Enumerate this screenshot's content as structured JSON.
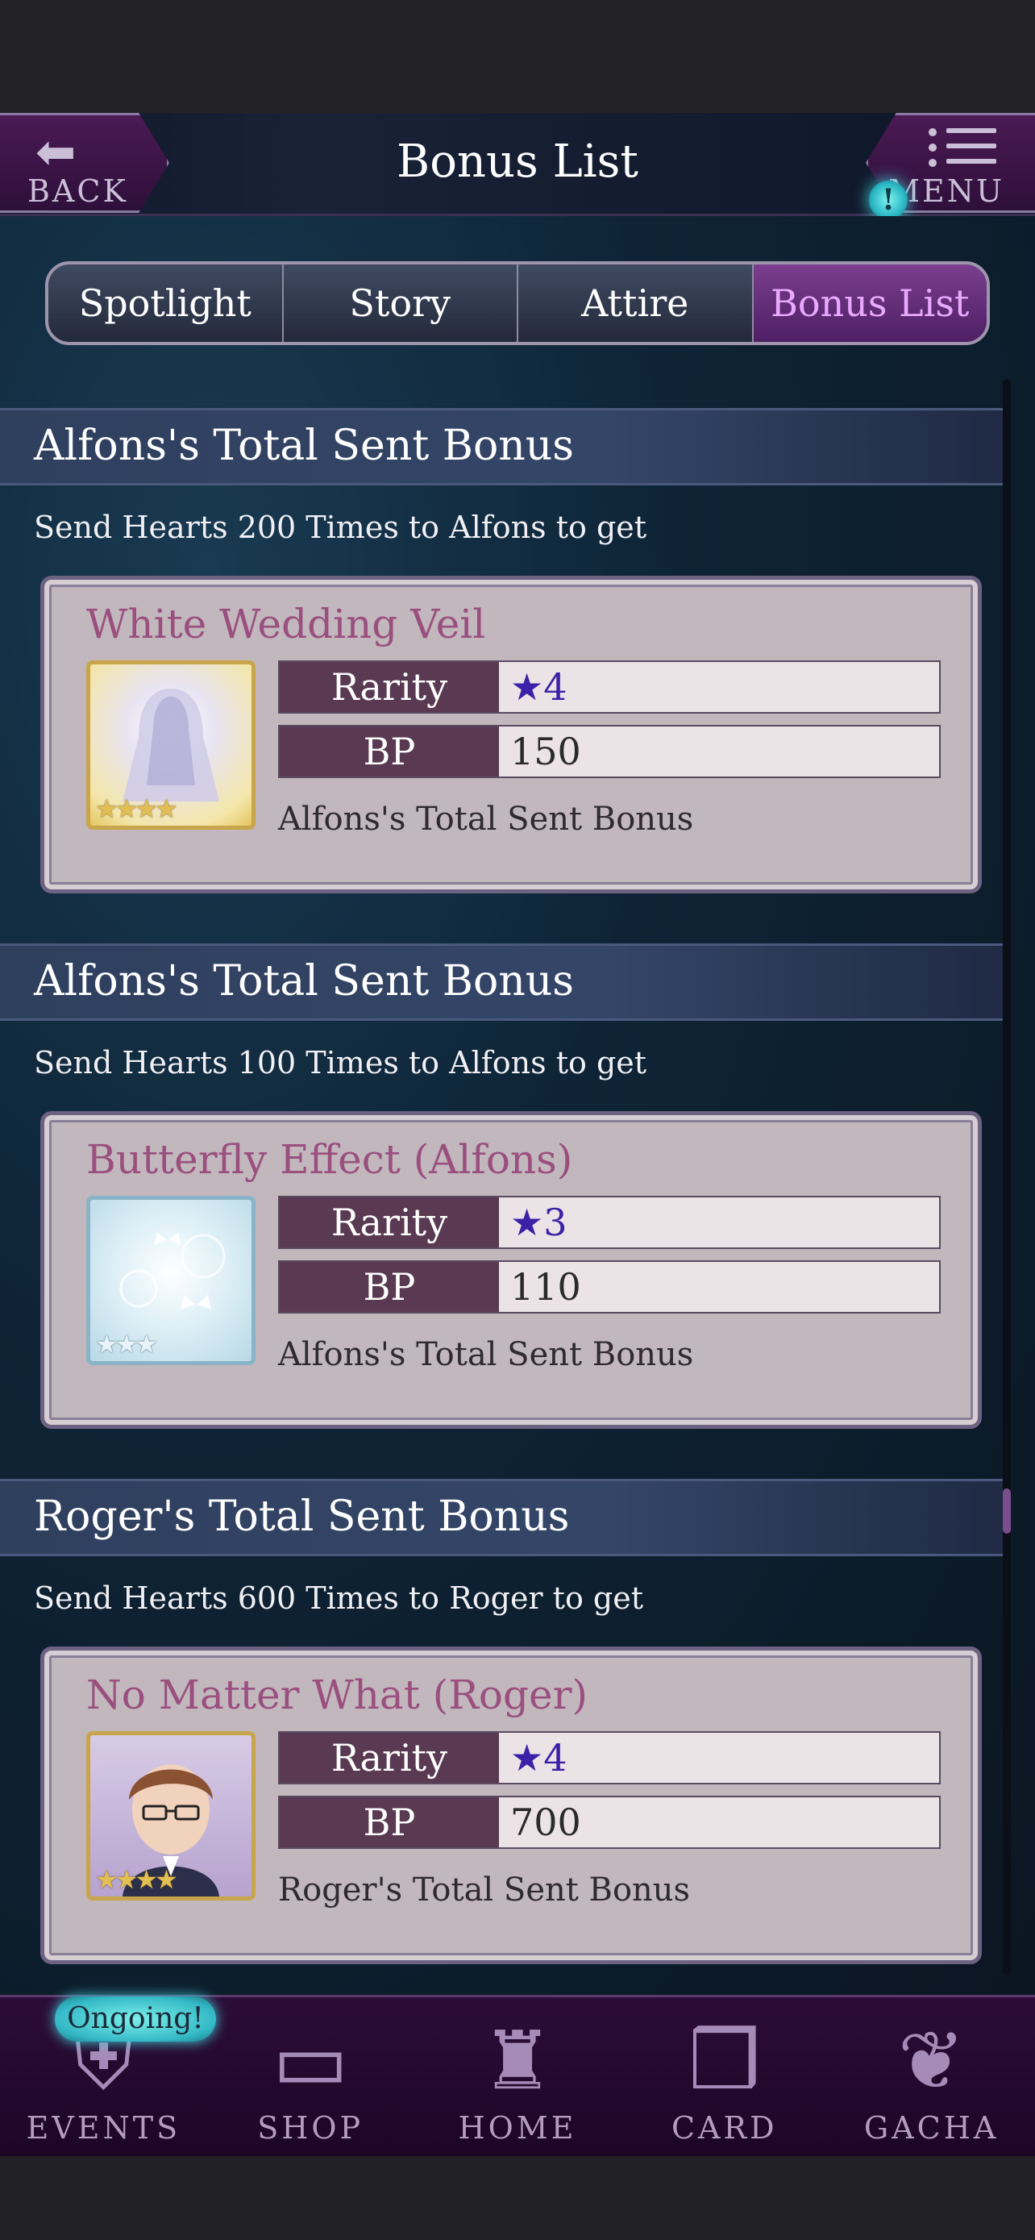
{
  "header": {
    "title": "Bonus List",
    "back_label": "BACK",
    "menu_label": "MENU",
    "menu_alert": "!"
  },
  "tabs": [
    {
      "label": "Spotlight",
      "active": false
    },
    {
      "label": "Story",
      "active": false
    },
    {
      "label": "Attire",
      "active": false
    },
    {
      "label": "Bonus List",
      "active": true
    }
  ],
  "bonuses": [
    {
      "section_title": "Alfons's Total Sent Bonus",
      "condition": "Send Hearts 200 Times to Alfons to get",
      "item_name": "White Wedding Veil",
      "rarity_label": "Rarity",
      "rarity": "★4",
      "bp_label": "BP",
      "bp": "150",
      "source": "Alfons's Total Sent Bonus",
      "thumb_stars": "★★★★"
    },
    {
      "section_title": "Alfons's Total Sent Bonus",
      "condition": "Send Hearts 100 Times to Alfons to get",
      "item_name": "Butterfly Effect (Alfons)",
      "rarity_label": "Rarity",
      "rarity": "★3",
      "bp_label": "BP",
      "bp": "110",
      "source": "Alfons's Total Sent Bonus",
      "thumb_stars": "★★★"
    },
    {
      "section_title": "Roger's Total Sent Bonus",
      "condition": "Send Hearts 600 Times to Roger to get",
      "item_name": "No Matter What (Roger)",
      "rarity_label": "Rarity",
      "rarity": "★4",
      "bp_label": "BP",
      "bp": "700",
      "source": "Roger's Total Sent Bonus",
      "thumb_stars": "★★★★"
    }
  ],
  "bottom_nav": {
    "ongoing_badge": "Ongoing!",
    "items": [
      {
        "label": "EVENTS",
        "icon": "events-crest-icon"
      },
      {
        "label": "SHOP",
        "icon": "shop-sign-icon"
      },
      {
        "label": "HOME",
        "icon": "castle-icon"
      },
      {
        "label": "CARD",
        "icon": "cards-icon"
      },
      {
        "label": "GACHA",
        "icon": "butterfly-icon"
      }
    ]
  },
  "colors": {
    "accent_pink": "#e9a9ff",
    "item_title": "#9a4f7e",
    "rarity_star": "#3b21a8",
    "nav_bg": "#2d0c38"
  }
}
